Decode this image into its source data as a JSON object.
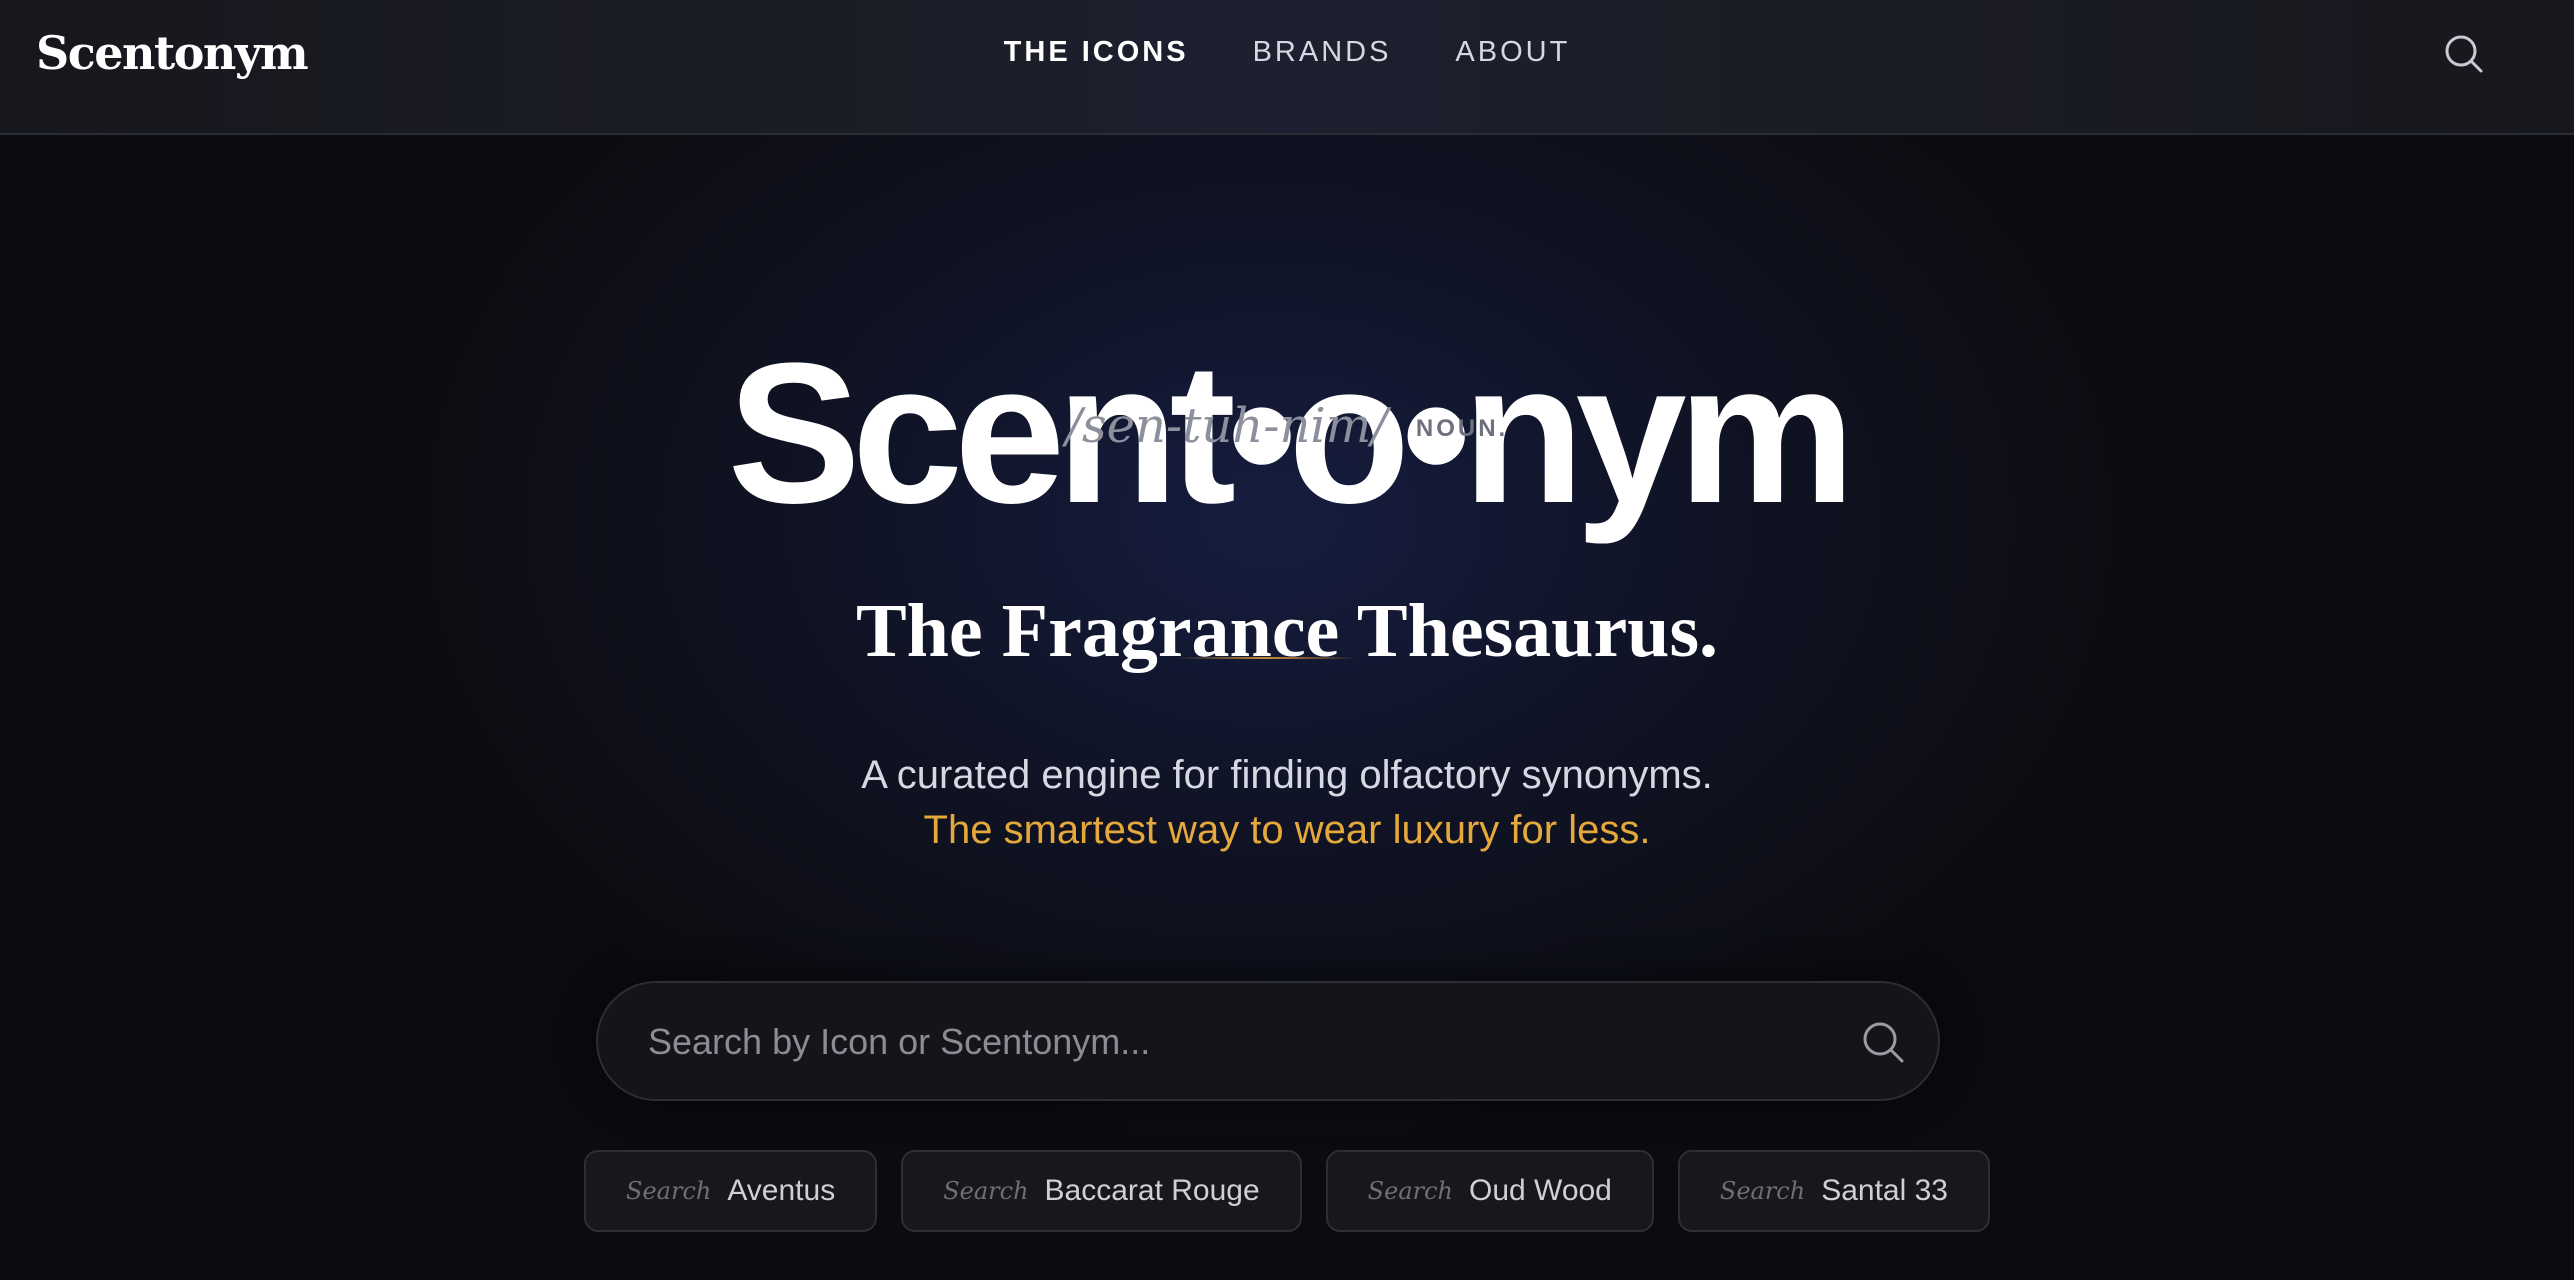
{
  "header": {
    "logo": "Scentonym",
    "nav": [
      {
        "label": "THE ICONS",
        "active": true
      },
      {
        "label": "BRANDS",
        "active": false
      },
      {
        "label": "ABOUT",
        "active": false
      }
    ],
    "search_icon": "search-icon"
  },
  "hero": {
    "wordmark": "Scent•o•nym",
    "pronunciation": "/sen-tuh-nim/",
    "part_of_speech": "NOUN.",
    "tagline": "The Fragrance Thesaurus.",
    "description": "A curated engine for finding olfactory synonyms.",
    "promo": "The smartest way to wear luxury for less."
  },
  "search": {
    "placeholder": "Search by Icon or Scentonym...",
    "value": "",
    "icon": "search-icon"
  },
  "quick_searches": [
    {
      "prefix": "Search",
      "name": "Aventus"
    },
    {
      "prefix": "Search",
      "name": "Baccarat Rouge"
    },
    {
      "prefix": "Search",
      "name": "Oud Wood"
    },
    {
      "prefix": "Search",
      "name": "Santal 33"
    }
  ],
  "colors": {
    "accent_gold": "#e4a83b",
    "background": "#0c0c10",
    "hero_navy": "#161e42"
  }
}
